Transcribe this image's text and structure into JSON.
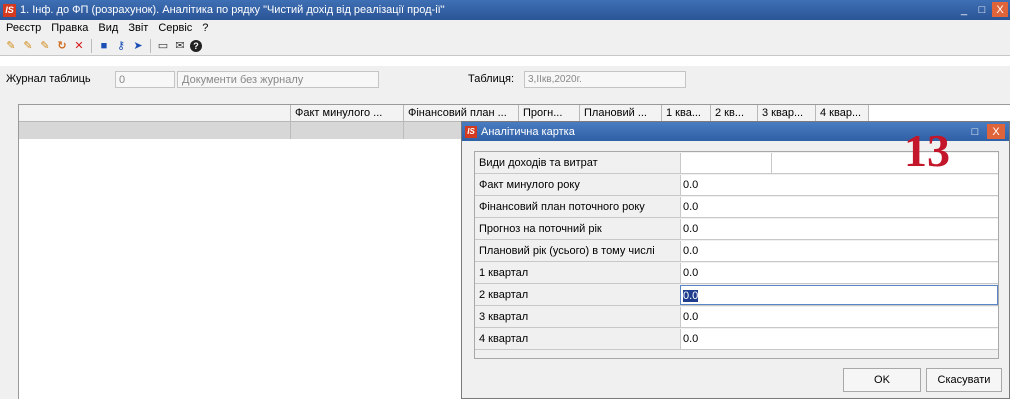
{
  "window": {
    "logo": "IS",
    "title": "1. Інф. до ФП (розрахунок). Аналітика по рядку \"Чистий дохід від реалізації прод-ії\"",
    "minimize": "_",
    "maximize": "□",
    "close": "X"
  },
  "menu": [
    "Реєстр",
    "Правка",
    "Вид",
    "Звіт",
    "Сервіс",
    "?"
  ],
  "toolbar": {
    "icons": [
      "new-icon",
      "copy-icon",
      "new-folder-icon",
      "refresh-icon",
      "delete-icon",
      "save-icon",
      "key-icon",
      "arrow-icon",
      "form-icon",
      "mail-icon",
      "help-icon"
    ],
    "glyphs": [
      "✎",
      "✎",
      "✎",
      "↻",
      "✕",
      "■",
      "⚷",
      "➤",
      "▭",
      "✉",
      "?"
    ]
  },
  "journal": {
    "label": "Журнал таблиць",
    "number": "0",
    "document": "Документи без журналу",
    "table_label": "Таблиця:",
    "table_value": "3,IIкв,2020г."
  },
  "grid": {
    "columns": [
      "",
      "Факт минулого ...",
      "Фінансовий план ...",
      "Прогн...",
      "Плановий ...",
      "1 ква...",
      "2 кв...",
      "3 квар...",
      "4 квар..."
    ]
  },
  "dialog": {
    "logo": "IS",
    "title": "Аналітична картка",
    "maximize": "□",
    "close": "X",
    "badge": "13",
    "rows": [
      {
        "label": "Види доходів та витрат",
        "value": ""
      },
      {
        "label": "Факт минулого року",
        "value": "0.0"
      },
      {
        "label": "Фінансовий план поточного року",
        "value": "0.0"
      },
      {
        "label": "Прогноз на поточний рік",
        "value": "0.0"
      },
      {
        "label": "Плановий рік (усього) в тому числі",
        "value": "0.0"
      },
      {
        "label": "1 квартал",
        "value": "0.0"
      },
      {
        "label": "2 квартал",
        "value": "0.0"
      },
      {
        "label": "3 квартал",
        "value": "0.0"
      },
      {
        "label": "4 квартал",
        "value": "0.0"
      }
    ],
    "ok": "OK",
    "cancel": "Скасувати"
  },
  "colors": {
    "title_bar": "#2f60a6",
    "close_button": "#e0643a",
    "badge": "#c4162a",
    "selection": "#1e3d8f"
  }
}
